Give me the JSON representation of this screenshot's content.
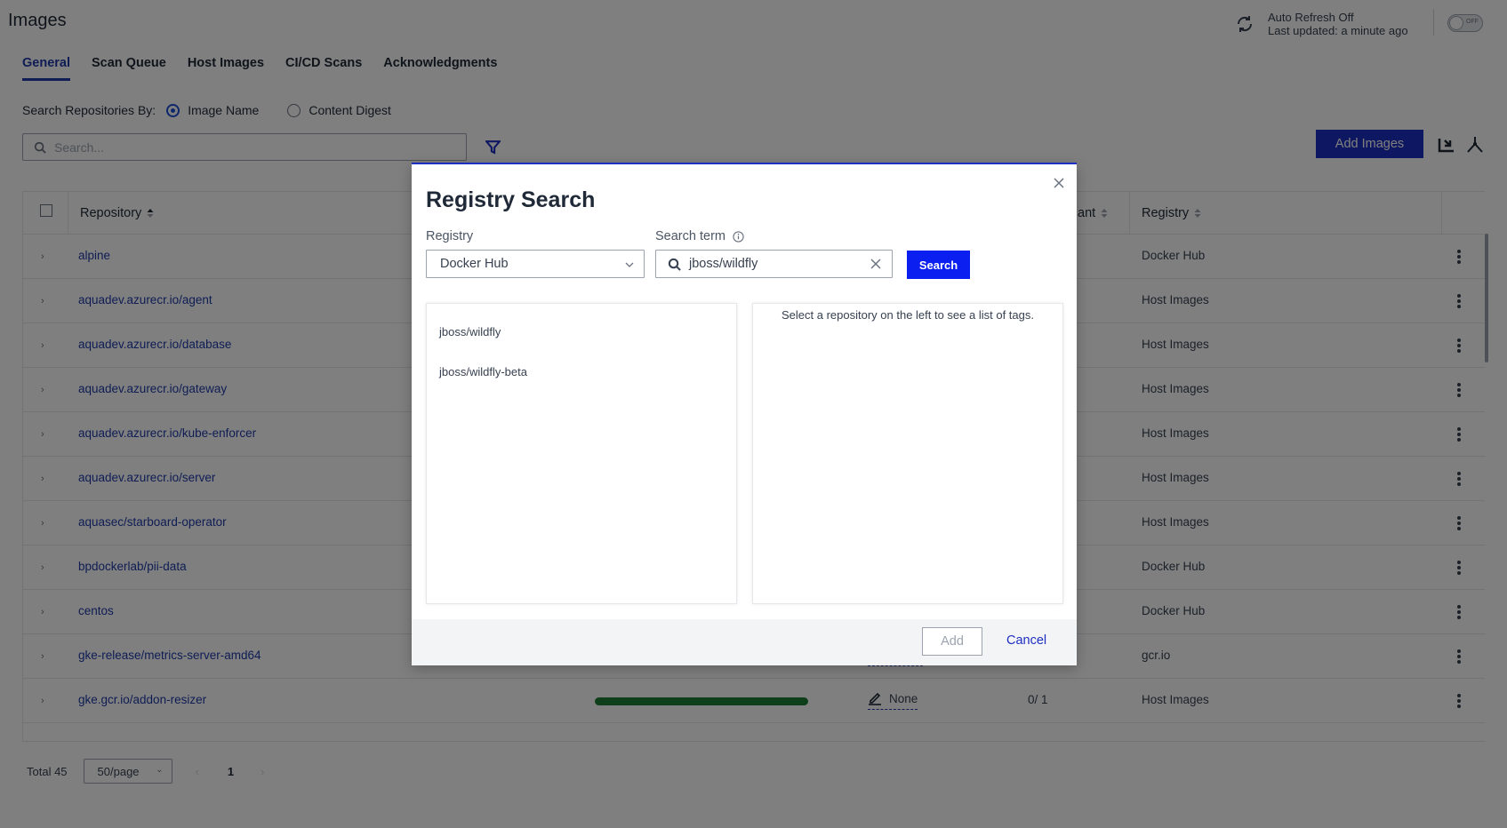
{
  "page": {
    "title": "Images",
    "auto_refresh": {
      "status": "Auto Refresh Off",
      "last_updated": "Last updated: a minute ago",
      "toggle_label": "OFF"
    }
  },
  "tabs": [
    {
      "label": "General",
      "active": true
    },
    {
      "label": "Scan Queue",
      "active": false
    },
    {
      "label": "Host Images",
      "active": false
    },
    {
      "label": "CI/CD Scans",
      "active": false
    },
    {
      "label": "Acknowledgments",
      "active": false
    }
  ],
  "search": {
    "by_label": "Search Repositories By:",
    "options": [
      {
        "label": "Image Name",
        "checked": true
      },
      {
        "label": "Content Digest",
        "checked": false
      }
    ],
    "placeholder": "Search..."
  },
  "toolbar": {
    "add_images_label": "Add Images"
  },
  "table": {
    "columns": {
      "repository": "Repository",
      "compliant_partial": "ant",
      "registry": "Registry"
    },
    "rows": [
      {
        "repository": "alpine",
        "registry": "Docker Hub"
      },
      {
        "repository": "aquadev.azurecr.io/agent",
        "registry": "Host Images"
      },
      {
        "repository": "aquadev.azurecr.io/database",
        "registry": "Host Images"
      },
      {
        "repository": "aquadev.azurecr.io/gateway",
        "registry": "Host Images"
      },
      {
        "repository": "aquadev.azurecr.io/kube-enforcer",
        "registry": "Host Images"
      },
      {
        "repository": "aquadev.azurecr.io/server",
        "registry": "Host Images"
      },
      {
        "repository": "aquasec/starboard-operator",
        "registry": "Host Images"
      },
      {
        "repository": "bpdockerlab/pii-data",
        "registry": "Docker Hub"
      },
      {
        "repository": "centos",
        "registry": "Docker Hub"
      },
      {
        "repository": "gke-release/metrics-server-amd64",
        "registry": "gcr.io"
      },
      {
        "repository": "gke.gcr.io/addon-resizer",
        "registry": "Host Images",
        "ack": "None",
        "count": "0/ 1"
      }
    ]
  },
  "footer": {
    "total": "Total 45",
    "page_size": "50/page",
    "current_page": "1"
  },
  "modal": {
    "title": "Registry Search",
    "registry_label": "Registry",
    "registry_value": "Docker Hub",
    "search_term_label": "Search term",
    "search_term_value": "jboss/wildfly",
    "search_button": "Search",
    "results": [
      "jboss/wildfly",
      "jboss/wildfly-beta"
    ],
    "tags_hint": "Select a repository on the left to see a list of tags.",
    "add_button": "Add",
    "cancel_button": "Cancel"
  },
  "colors": {
    "primary": "#1d2ec2",
    "link": "#1e3aa8",
    "progress": "#1e7e34"
  }
}
